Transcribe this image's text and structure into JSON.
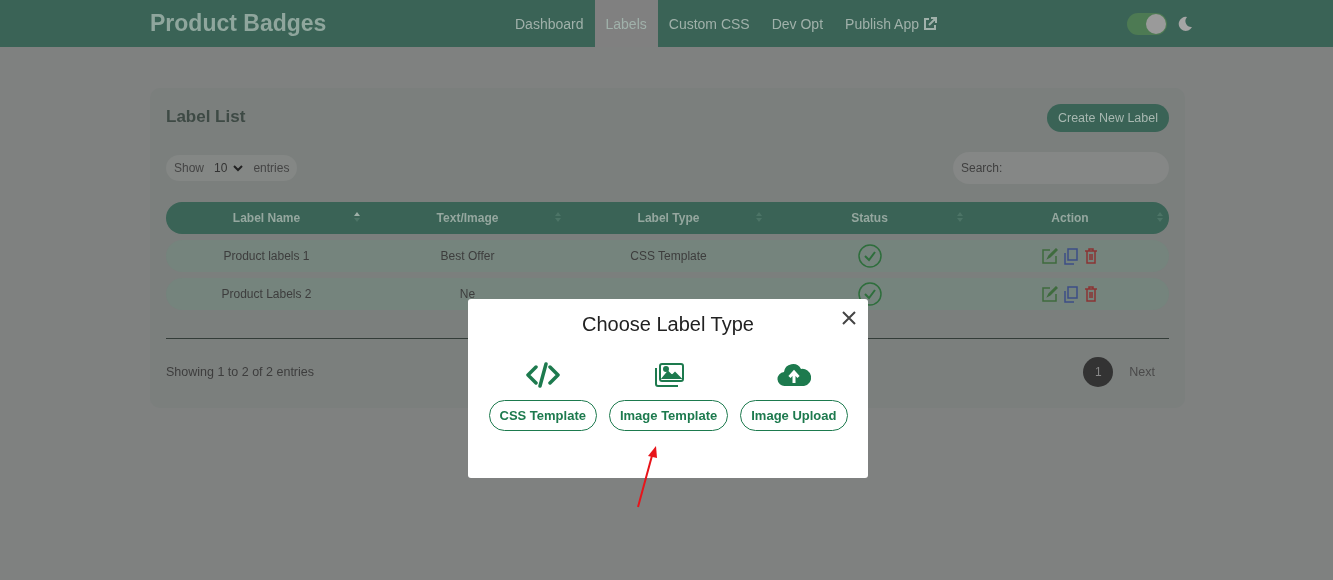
{
  "header": {
    "brand": "Product Badges",
    "nav": [
      {
        "label": "Dashboard",
        "selected": false,
        "external": false
      },
      {
        "label": "Labels",
        "selected": true,
        "external": false
      },
      {
        "label": "Custom CSS",
        "selected": false,
        "external": false
      },
      {
        "label": "Dev Opt",
        "selected": false,
        "external": false
      },
      {
        "label": "Publish App",
        "selected": false,
        "external": true
      }
    ],
    "theme_switch": {
      "on": true
    }
  },
  "card": {
    "title": "Label List",
    "create_button": "Create New Label",
    "length": {
      "prefix": "Show",
      "value": "10",
      "suffix": "entries"
    },
    "search": {
      "placeholder": "Search:"
    },
    "table": {
      "columns": [
        {
          "label": "Label Name",
          "sorted": true
        },
        {
          "label": "Text/Image",
          "sorted": false
        },
        {
          "label": "Label Type",
          "sorted": false
        },
        {
          "label": "Status",
          "sorted": false
        },
        {
          "label": "Action",
          "sorted": false
        }
      ],
      "rows": [
        {
          "name": "Product labels 1",
          "text": "Best Offer",
          "type": "CSS Template",
          "active": true
        },
        {
          "name": "Product Labels 2",
          "text": "Ne",
          "type": "",
          "active": true
        }
      ]
    },
    "info": "Showing 1 to 2 of 2 entries",
    "pagination": {
      "pages": [
        {
          "label": "1",
          "selected": true
        }
      ],
      "next": "Next"
    }
  },
  "modal": {
    "title": "Choose Label Type",
    "options": [
      {
        "kind": "code",
        "label": "CSS Template"
      },
      {
        "kind": "images",
        "label": "Image Template"
      },
      {
        "kind": "upload",
        "label": "Image Upload"
      }
    ]
  }
}
